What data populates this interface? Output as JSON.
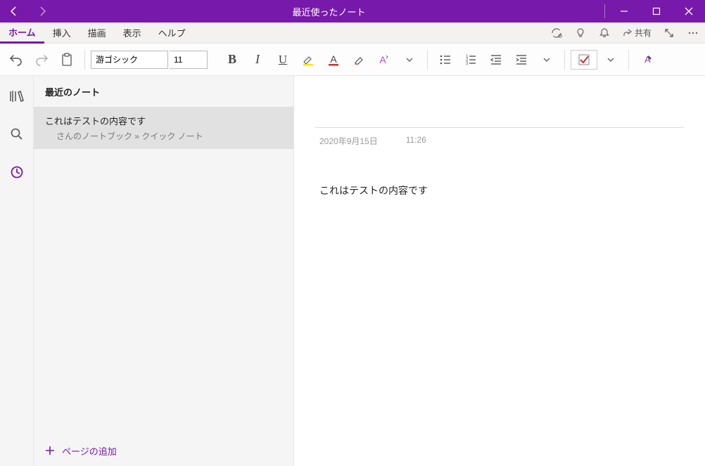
{
  "window": {
    "title": "最近使ったノート"
  },
  "tabs": {
    "home": "ホーム",
    "insert": "挿入",
    "draw": "描画",
    "view": "表示",
    "help": "ヘルプ",
    "share": "共有"
  },
  "ribbon": {
    "font_name": "游ゴシック",
    "font_size": "11"
  },
  "leftrail": {},
  "notelist": {
    "header": "最近のノート",
    "items": [
      {
        "title": "これはテストの内容です",
        "path": "さんのノートブック » クイック ノート"
      }
    ],
    "add_page": "ページの追加"
  },
  "page": {
    "title": "",
    "date": "2020年9月15日",
    "time": "11:26",
    "body": "これはテストの内容です"
  }
}
